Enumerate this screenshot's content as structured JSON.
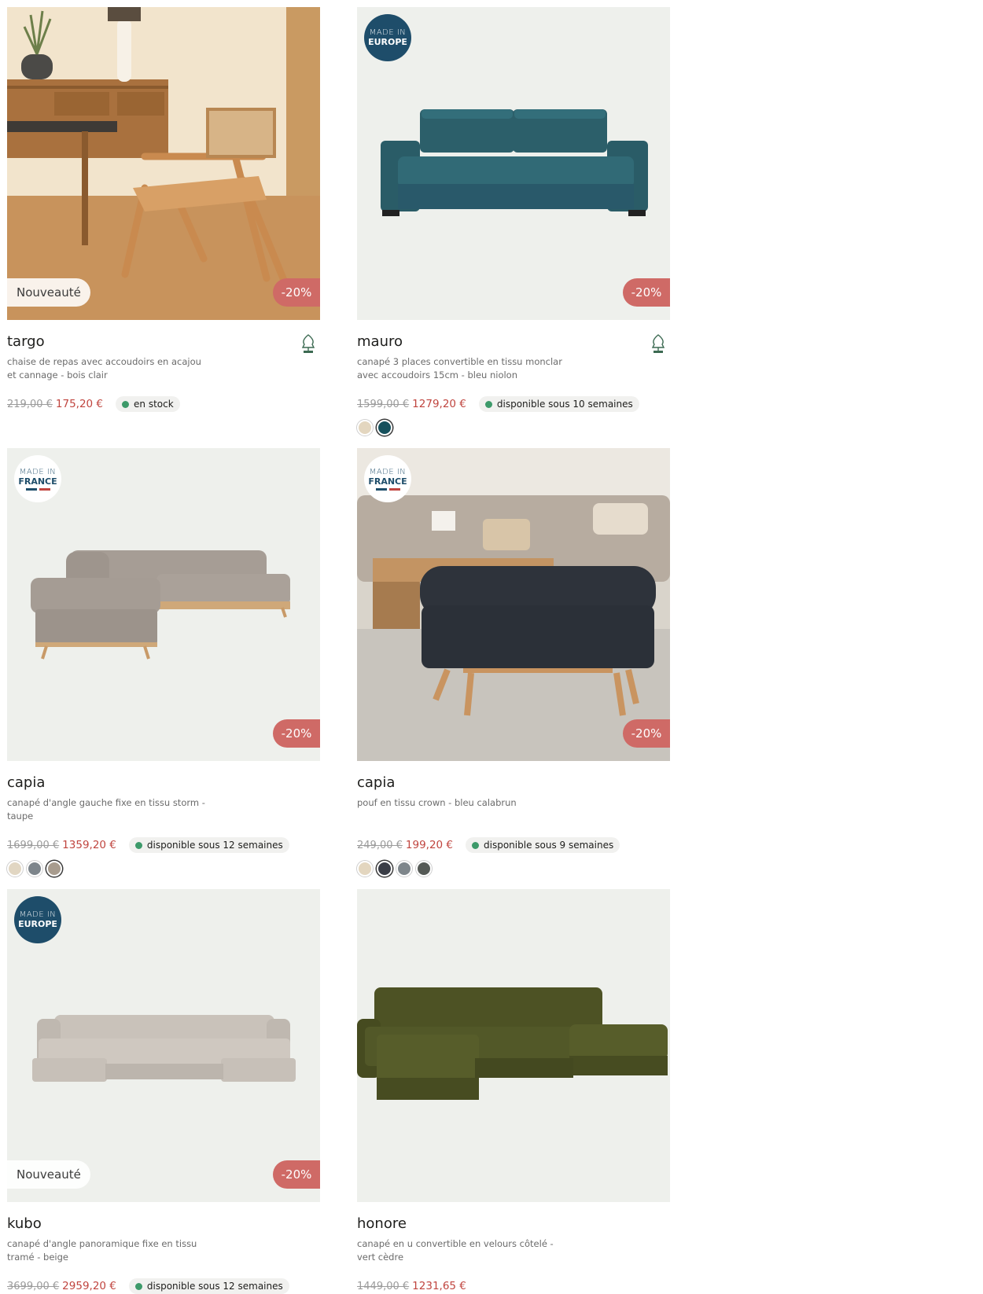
{
  "products": [
    {
      "name": "targo",
      "description": "chaise de repas avec accoudoirs en acajou et cannage - bois clair",
      "old_price": "219,00 €",
      "new_price": "175,20 €",
      "availability": "en stock",
      "badge_new": "Nouveauté",
      "discount": "-20%",
      "made_in": null,
      "fsc_icon": "fsc-tree-icon",
      "swatches": []
    },
    {
      "name": "mauro",
      "description": "canapé 3 places convertible en tissu monclar avec accoudoirs 15cm - bleu niolon",
      "old_price": "1599,00 €",
      "new_price": "1279,20 €",
      "availability": "disponible sous 10 semaines",
      "discount": "-20%",
      "made_in": {
        "line1": "MADE IN",
        "line2": "EUROPE"
      },
      "fsc_icon": "fsc-tree-icon",
      "swatches": [
        {
          "color": "#e3d6bf",
          "selected": false
        },
        {
          "color": "#16505c",
          "selected": true
        }
      ]
    },
    {
      "name": "capia",
      "description": "canapé d'angle gauche fixe en tissu storm - taupe",
      "old_price": "1699,00 €",
      "new_price": "1359,20 €",
      "availability": "disponible sous 12 semaines",
      "discount": "-20%",
      "made_in": {
        "line1": "MADE IN",
        "line2": "FRANCE"
      },
      "swatches": [
        {
          "color": "#e1d6c2",
          "selected": false
        },
        {
          "color": "#7d858b",
          "selected": false
        },
        {
          "color": "#a89c8e",
          "selected": true
        }
      ]
    },
    {
      "name": "capia",
      "description": "pouf en tissu crown - bleu calabrun",
      "old_price": "249,00 €",
      "new_price": "199,20 €",
      "availability": "disponible sous 9 semaines",
      "discount": "-20%",
      "made_in": {
        "line1": "MADE IN",
        "line2": "FRANCE"
      },
      "swatches": [
        {
          "color": "#e3d6bf",
          "selected": false
        },
        {
          "color": "#3a3d46",
          "selected": true
        },
        {
          "color": "#7e868b",
          "selected": false
        },
        {
          "color": "#555a56",
          "selected": false
        }
      ]
    },
    {
      "name": "kubo",
      "description": "canapé d'angle panoramique fixe en tissu tramé - beige",
      "old_price": "3699,00 €",
      "new_price": "2959,20 €",
      "availability": "disponible sous 12 semaines",
      "badge_new": "Nouveauté",
      "discount": "-20%",
      "made_in": {
        "line1": "MADE IN",
        "line2": "EUROPE"
      },
      "swatches": []
    },
    {
      "name": "honore",
      "description": "canapé en u convertible en velours côtelé - vert cèdre",
      "old_price": "1449,00 €",
      "new_price": "1231,65 €",
      "availability": null,
      "made_in": null,
      "swatches": []
    }
  ],
  "colors": {
    "discount_bg": "#cf6a66",
    "price_accent": "#c0453f",
    "stock_dot": "#3d9a6a",
    "europe_badge": "#1e4d6a",
    "image_bg": "#eef0ec"
  }
}
